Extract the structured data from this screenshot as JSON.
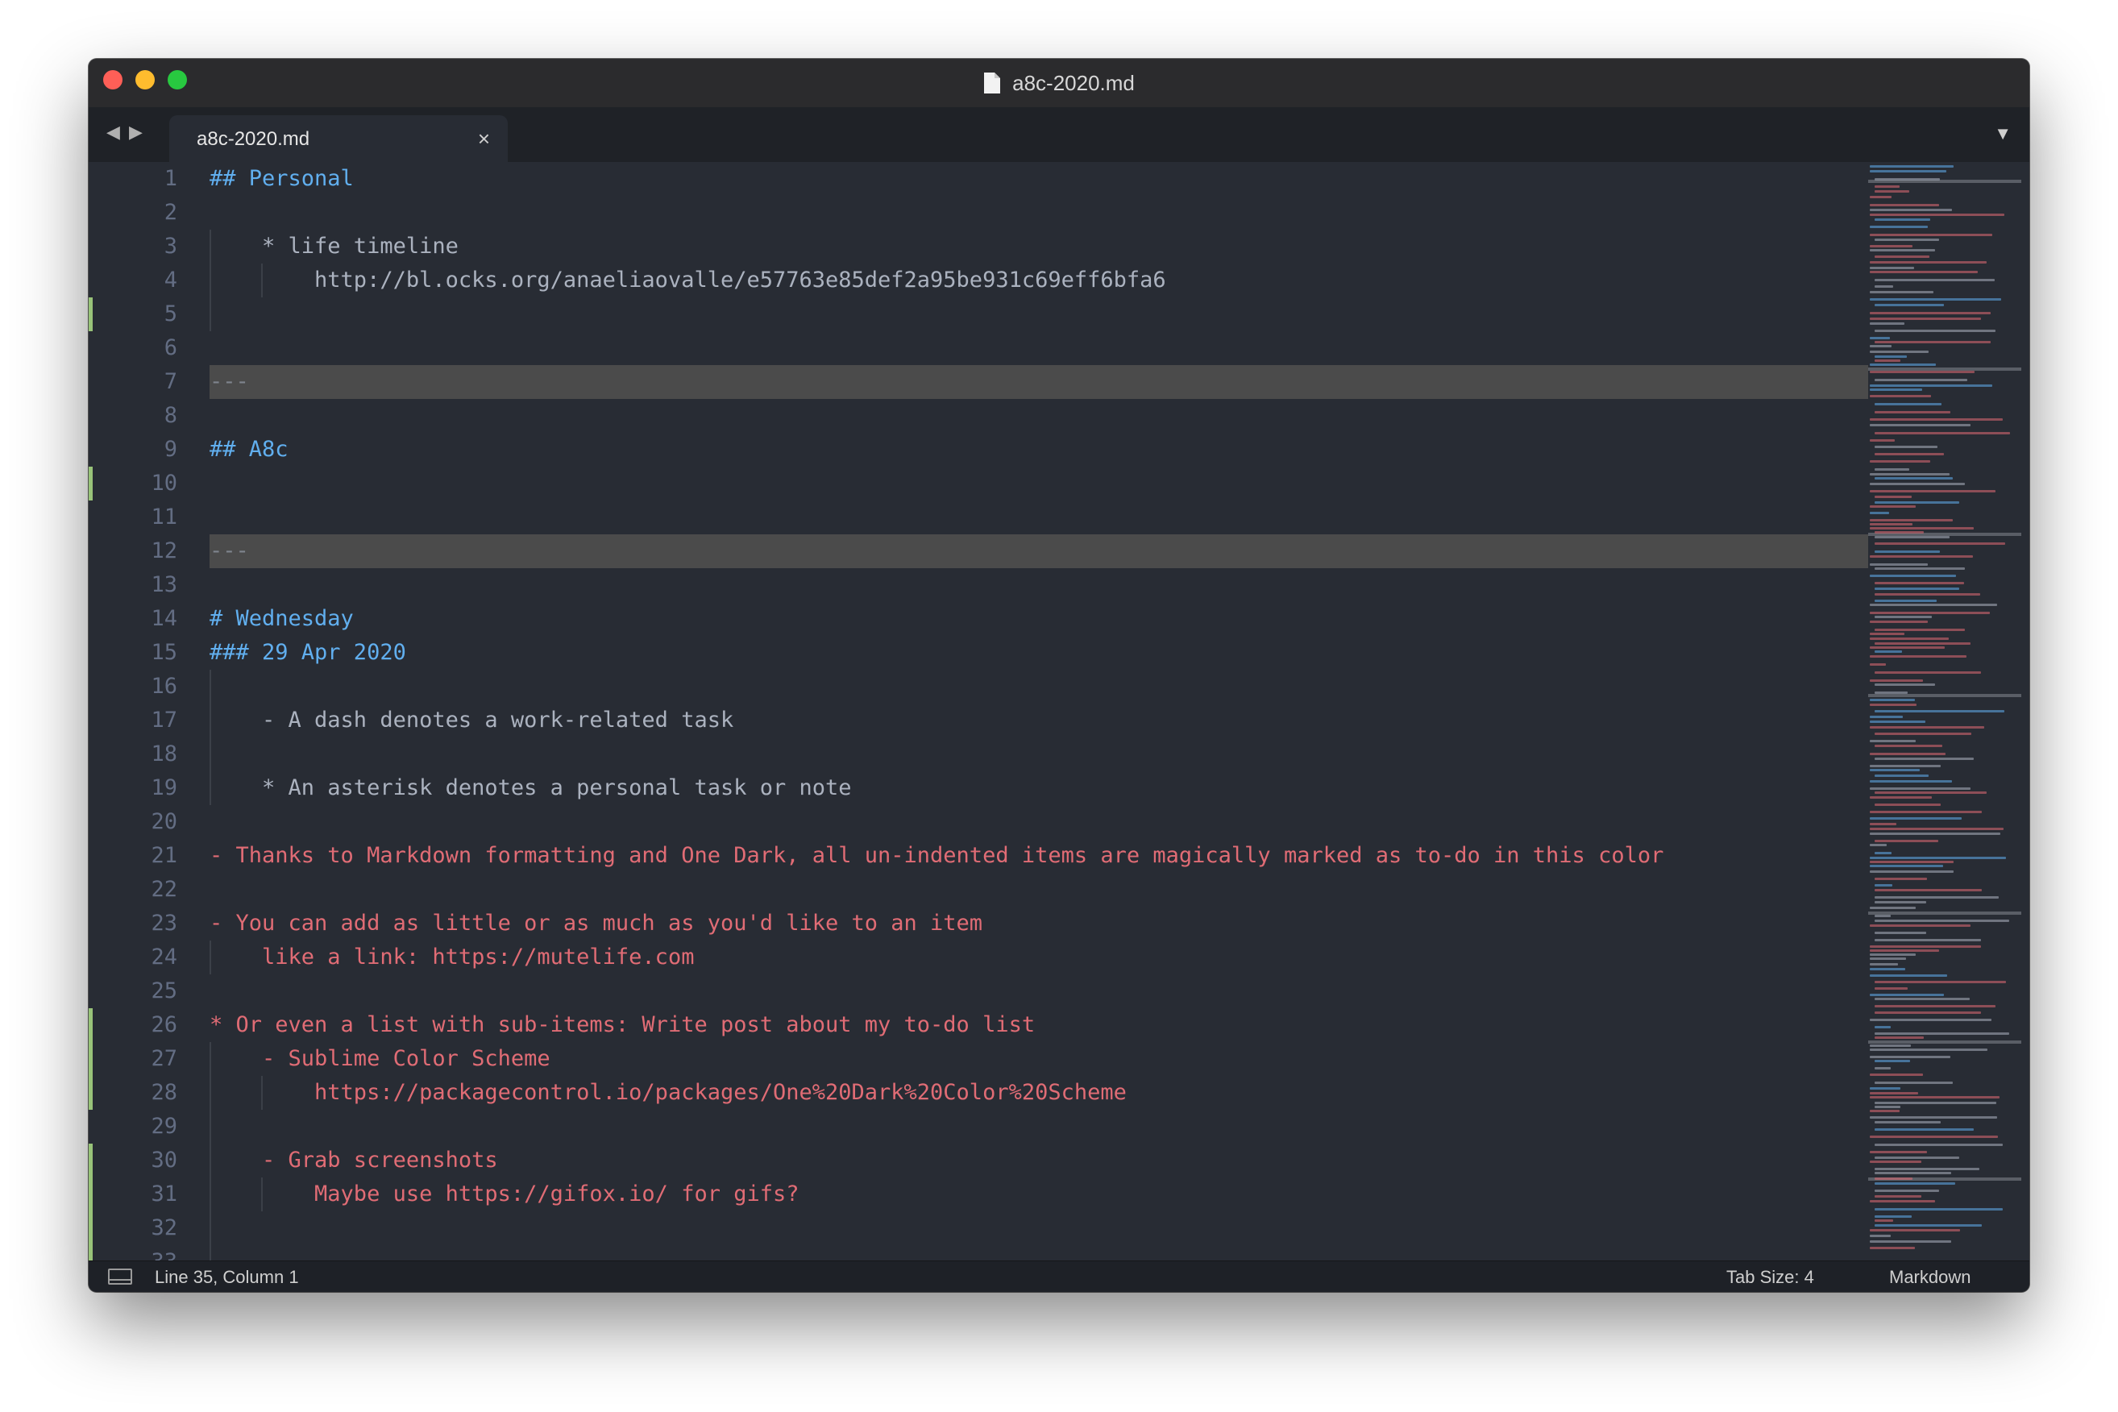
{
  "window": {
    "title": "a8c-2020.md"
  },
  "tabs": [
    {
      "label": "a8c-2020.md",
      "close": "×"
    }
  ],
  "nav": {
    "back": "◀",
    "forward": "▶",
    "dropdown": "▼"
  },
  "editor": {
    "lines": [
      {
        "n": "1",
        "text": "## Personal",
        "style": "head"
      },
      {
        "n": "2",
        "text": "",
        "style": "text"
      },
      {
        "n": "3",
        "text": "    * life timeline",
        "style": "text"
      },
      {
        "n": "4",
        "text": "        http://bl.ocks.org/anaeliaovalle/e57763e85def2a95be931c69eff6bfa6",
        "style": "text"
      },
      {
        "n": "5",
        "text": "",
        "style": "text"
      },
      {
        "n": "6",
        "text": "",
        "style": "text"
      },
      {
        "n": "7",
        "text": "---",
        "style": "hr"
      },
      {
        "n": "8",
        "text": "",
        "style": "text"
      },
      {
        "n": "9",
        "text": "## A8c",
        "style": "head"
      },
      {
        "n": "10",
        "text": "",
        "style": "text"
      },
      {
        "n": "11",
        "text": "",
        "style": "text"
      },
      {
        "n": "12",
        "text": "---",
        "style": "hr"
      },
      {
        "n": "13",
        "text": "",
        "style": "text"
      },
      {
        "n": "14",
        "text": "# Wednesday",
        "style": "head"
      },
      {
        "n": "15",
        "text": "### 29 Apr 2020",
        "style": "head"
      },
      {
        "n": "16",
        "text": "",
        "style": "text"
      },
      {
        "n": "17",
        "text": "    - A dash denotes a work-related task",
        "style": "text"
      },
      {
        "n": "18",
        "text": "",
        "style": "text"
      },
      {
        "n": "19",
        "text": "    * An asterisk denotes a personal task or note",
        "style": "text"
      },
      {
        "n": "20",
        "text": "",
        "style": "text"
      },
      {
        "n": "21",
        "text": "- Thanks to Markdown formatting and One Dark, all un-indented items are magically marked as to-do in this color",
        "style": "todo"
      },
      {
        "n": "22",
        "text": "",
        "style": "text"
      },
      {
        "n": "23",
        "text": "- You can add as little or as much as you'd like to an item",
        "style": "todo"
      },
      {
        "n": "24",
        "text": "    like a link: https://mutelife.com",
        "style": "todo"
      },
      {
        "n": "25",
        "text": "",
        "style": "text"
      },
      {
        "n": "26",
        "text": "* Or even a list with sub-items: Write post about my to-do list",
        "style": "todo"
      },
      {
        "n": "27",
        "text": "    - Sublime Color Scheme",
        "style": "todo"
      },
      {
        "n": "28",
        "text": "        https://packagecontrol.io/packages/One%20Dark%20Color%20Scheme",
        "style": "todo"
      },
      {
        "n": "29",
        "text": "",
        "style": "text"
      },
      {
        "n": "30",
        "text": "    - Grab screenshots",
        "style": "todo"
      },
      {
        "n": "31",
        "text": "        Maybe use https://gifox.io/ for gifs?",
        "style": "todo"
      },
      {
        "n": "32",
        "text": "",
        "style": "text"
      },
      {
        "n": "33",
        "text": "",
        "style": "text"
      }
    ]
  },
  "colors": {
    "background": "#282c34",
    "heading": "#61afef",
    "text": "#abb2bf",
    "todo": "#e06c75",
    "modified": "#98c379"
  },
  "status": {
    "position": "Line 35, Column 1",
    "tab_size": "Tab Size: 4",
    "syntax": "Markdown"
  }
}
